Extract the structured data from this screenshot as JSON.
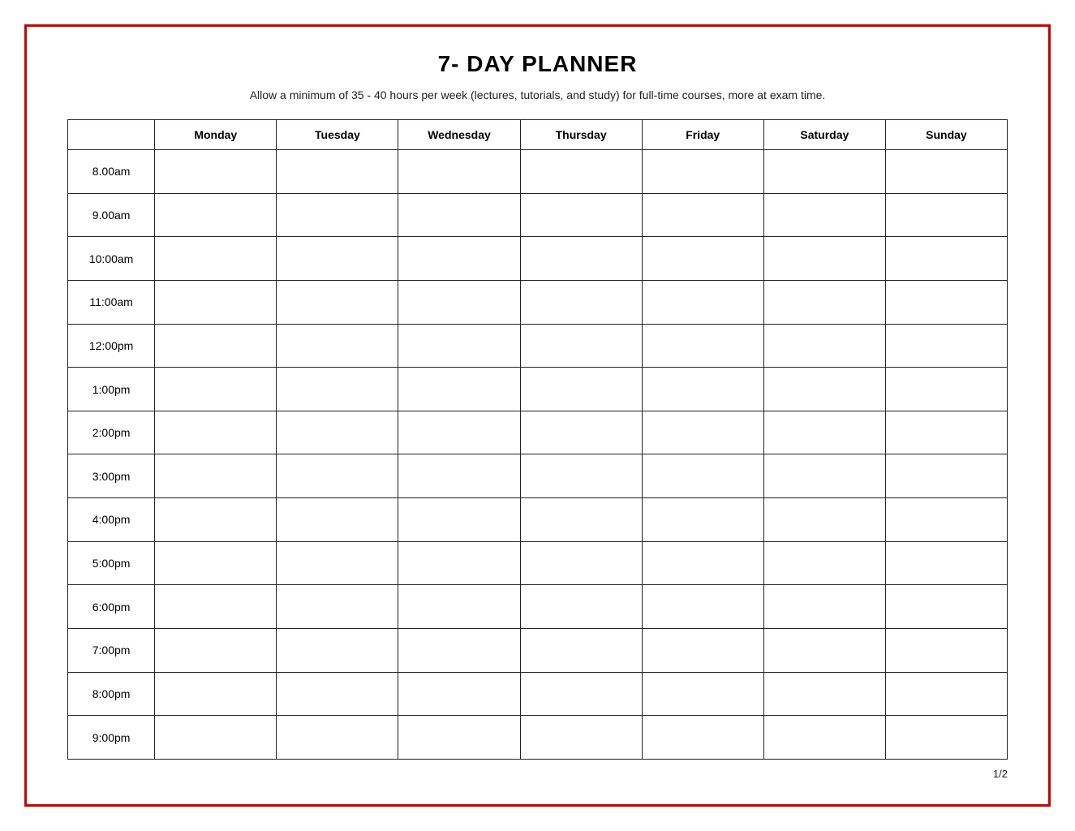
{
  "page": {
    "title": "7- DAY PLANNER",
    "subtitle": "Allow a minimum of 35 - 40 hours per week (lectures, tutorials, and study) for full-time courses, more at exam time.",
    "page_number": "1/2"
  },
  "table": {
    "headers": [
      "",
      "Monday",
      "Tuesday",
      "Wednesday",
      "Thursday",
      "Friday",
      "Saturday",
      "Sunday"
    ],
    "time_slots": [
      "8.00am",
      "9.00am",
      "10:00am",
      "11:00am",
      "12:00pm",
      "1:00pm",
      "2:00pm",
      "3:00pm",
      "4:00pm",
      "5:00pm",
      "6:00pm",
      "7:00pm",
      "8:00pm",
      "9:00pm"
    ]
  }
}
